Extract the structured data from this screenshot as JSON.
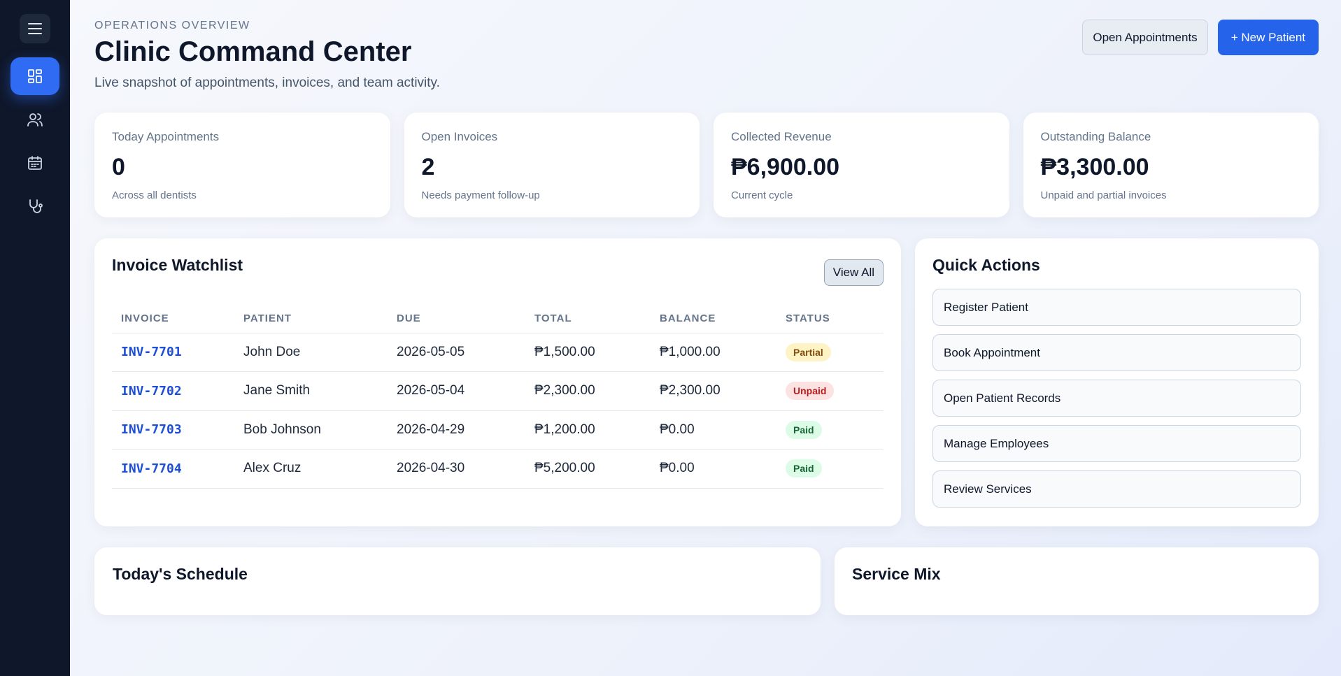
{
  "header": {
    "eyebrow": "OPERATIONS OVERVIEW",
    "title": "Clinic Command Center",
    "subtitle": "Live snapshot of appointments, invoices, and team activity.",
    "open_appointments_label": "Open Appointments",
    "new_patient_label": "+ New Patient"
  },
  "sidebar": {
    "items": [
      {
        "icon": "dashboard-icon",
        "active": true
      },
      {
        "icon": "users-icon",
        "active": false
      },
      {
        "icon": "calendar-icon",
        "active": false
      },
      {
        "icon": "stethoscope-icon",
        "active": false
      }
    ]
  },
  "stats": [
    {
      "label": "Today Appointments",
      "value": "0",
      "hint": "Across all dentists"
    },
    {
      "label": "Open Invoices",
      "value": "2",
      "hint": "Needs payment follow-up"
    },
    {
      "label": "Collected Revenue",
      "value": "₱6,900.00",
      "hint": "Current cycle"
    },
    {
      "label": "Outstanding Balance",
      "value": "₱3,300.00",
      "hint": "Unpaid and partial invoices"
    }
  ],
  "watchlist": {
    "title": "Invoice Watchlist",
    "view_all_label": "View All",
    "columns": [
      "INVOICE",
      "PATIENT",
      "DUE",
      "TOTAL",
      "BALANCE",
      "STATUS"
    ],
    "rows": [
      {
        "invoice": "INV-7701",
        "patient": "John Doe",
        "due": "2026-05-05",
        "total": "₱1,500.00",
        "balance": "₱1,000.00",
        "status": "Partial"
      },
      {
        "invoice": "INV-7702",
        "patient": "Jane Smith",
        "due": "2026-05-04",
        "total": "₱2,300.00",
        "balance": "₱2,300.00",
        "status": "Unpaid"
      },
      {
        "invoice": "INV-7703",
        "patient": "Bob Johnson",
        "due": "2026-04-29",
        "total": "₱1,200.00",
        "balance": "₱0.00",
        "status": "Paid"
      },
      {
        "invoice": "INV-7704",
        "patient": "Alex Cruz",
        "due": "2026-04-30",
        "total": "₱5,200.00",
        "balance": "₱0.00",
        "status": "Paid"
      }
    ]
  },
  "quick_actions": {
    "title": "Quick Actions",
    "items": [
      "Register Patient",
      "Book Appointment",
      "Open Patient Records",
      "Manage Employees",
      "Review Services"
    ]
  },
  "schedule": {
    "title": "Today's Schedule"
  },
  "service_mix": {
    "title": "Service Mix"
  },
  "colors": {
    "sidebar_bg": "#0f172a",
    "accent": "#2563eb",
    "partial": "#854d0e",
    "unpaid": "#b91c1c",
    "paid": "#166534"
  }
}
